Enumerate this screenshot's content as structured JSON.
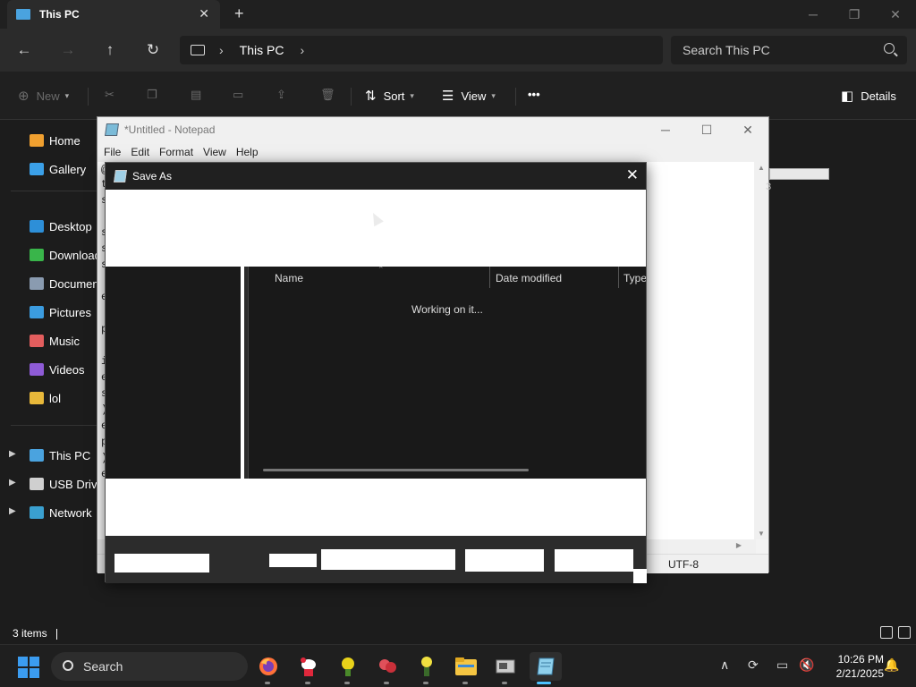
{
  "explorer": {
    "tab_title": "This PC",
    "new_tab": "+",
    "close_tab": "✕",
    "window_controls": [
      "─",
      "❐",
      "✕"
    ],
    "address": {
      "crumb": "This PC",
      "chevron": "›"
    },
    "search": {
      "placeholder": "Search This PC"
    },
    "commands": {
      "new": "New",
      "sort": "Sort",
      "view": "View",
      "more": "•••",
      "details": "Details"
    },
    "sidebar": {
      "items": [
        {
          "label": "Home",
          "icon": "home-icon",
          "color": "#f0a030"
        },
        {
          "label": "Gallery",
          "icon": "gallery-icon",
          "color": "#3ba0e8"
        },
        {
          "label": "Desktop",
          "icon": "desktop-icon",
          "color": "#2d8fd8"
        },
        {
          "label": "Download",
          "icon": "download-icon",
          "color": "#39b54a"
        },
        {
          "label": "Documen",
          "icon": "documents-icon",
          "color": "#8a9bb0"
        },
        {
          "label": "Pictures",
          "icon": "pictures-icon",
          "color": "#3b9ce0"
        },
        {
          "label": "Music",
          "icon": "music-icon",
          "color": "#e35e5e"
        },
        {
          "label": "Videos",
          "icon": "videos-icon",
          "color": "#8e5bd6"
        },
        {
          "label": "lol",
          "icon": "folder-icon",
          "color": "#e8b83a"
        },
        {
          "label": "This PC",
          "icon": "pc-icon",
          "color": "#4aa3df"
        },
        {
          "label": "USB Drive",
          "icon": "usb-drive-icon",
          "color": "#cfcfcf"
        },
        {
          "label": "Network",
          "icon": "network-icon",
          "color": "#3aa0d0"
        }
      ]
    },
    "status": {
      "items_count": "3 items"
    }
  },
  "notepad": {
    "title": "*Untitled - Notepad",
    "menu": [
      "File",
      "Edit",
      "Format",
      "View",
      "Help"
    ],
    "window_controls": [
      "─",
      "☐",
      "✕"
    ],
    "visible_chars": [
      "@",
      "t",
      "s",
      "s",
      "s",
      "s",
      "e",
      "p",
      "i",
      "e",
      "s",
      ")",
      "e",
      "p",
      ")",
      "e"
    ],
    "encoding": "UTF-8",
    "overflow_char": "3"
  },
  "save_dialog": {
    "title": "Save As",
    "close": "✕",
    "columns": [
      "Name",
      "Date modified",
      "Type"
    ],
    "loading_text": "Working on it..."
  },
  "taskbar": {
    "search_label": "Search",
    "apps": [
      "firefox-icon",
      "hello-kitty-icon",
      "yellow-creature-icon",
      "red-creature-icon",
      "yellow-figure-icon",
      "file-explorer-icon",
      "computer-app-icon",
      "notepad-icon"
    ],
    "time": "10:26 PM",
    "date": "2/21/2025"
  }
}
